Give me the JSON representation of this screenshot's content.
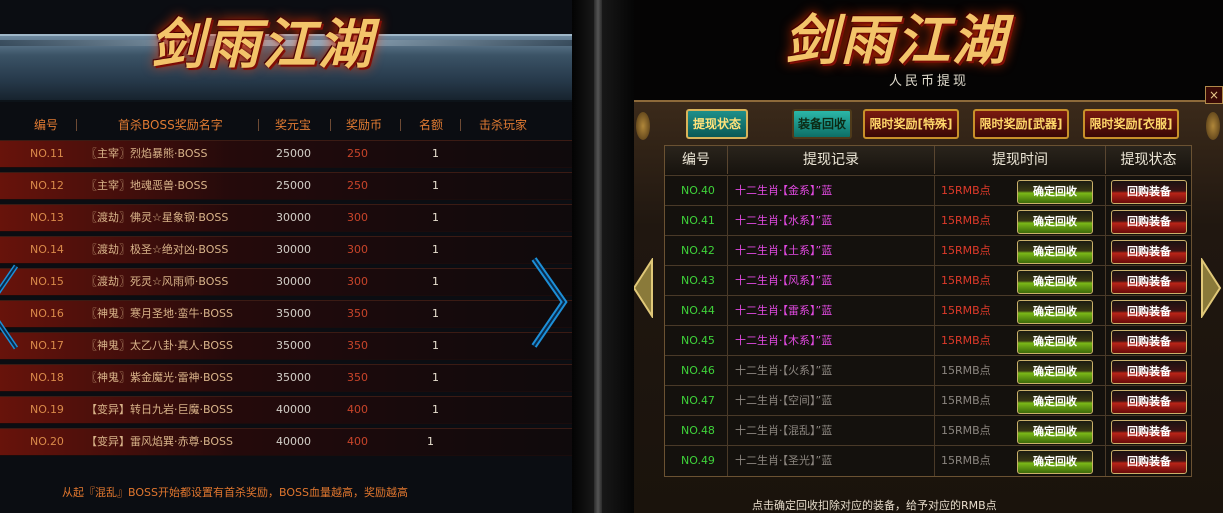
{
  "left": {
    "logo": "剑雨江湖",
    "headers": [
      "编号",
      "首杀BOSS奖励名字",
      "奖元宝",
      "奖励币",
      "名额",
      "击杀玩家"
    ],
    "rows": [
      {
        "no": "NO.11",
        "name": "〖主宰〗烈焰暴熊·BOSS",
        "gold": "25000",
        "coin": "250",
        "rank": "1"
      },
      {
        "no": "NO.12",
        "name": "〖主宰〗地魂恶兽·BOSS",
        "gold": "25000",
        "coin": "250",
        "rank": "1"
      },
      {
        "no": "NO.13",
        "name": "〖渡劫〗佛灵☆星象钢·BOSS",
        "gold": "30000",
        "coin": "300",
        "rank": "1"
      },
      {
        "no": "NO.14",
        "name": "〖渡劫〗极圣☆绝对凶·BOSS",
        "gold": "30000",
        "coin": "300",
        "rank": "1"
      },
      {
        "no": "NO.15",
        "name": "〖渡劫〗死灵☆风雨师·BOSS",
        "gold": "30000",
        "coin": "300",
        "rank": "1"
      },
      {
        "no": "NO.16",
        "name": "〖神鬼〗寒月圣地·蛮牛·BOSS",
        "gold": "35000",
        "coin": "350",
        "rank": "1"
      },
      {
        "no": "NO.17",
        "name": "〖神鬼〗太乙八卦·真人·BOSS",
        "gold": "35000",
        "coin": "350",
        "rank": "1"
      },
      {
        "no": "NO.18",
        "name": "〖神鬼〗紫金魔光·雷神·BOSS",
        "gold": "35000",
        "coin": "350",
        "rank": "1"
      },
      {
        "no": "NO.19",
        "name": "【变异】转日九岩·巨魔·BOSS",
        "gold": "40000",
        "coin": "400",
        "rank": "1"
      },
      {
        "no": "NO.20",
        "name": "【变异】雷风焰巽·赤尊·BOSS",
        "gold": "40000",
        "coin": "400",
        "rank": "1"
      }
    ],
    "note": "从起『混乱』BOSS开始都设置有首杀奖励，BOSS血量越高，奖励越高"
  },
  "right": {
    "logo": "剑雨江湖",
    "subtitle": "人民币提现",
    "close": "×",
    "tabs": {
      "status": "提现状态",
      "equip": "装备回收",
      "special": "限时奖励[特殊]",
      "weapon": "限时奖励[武器]",
      "clothes": "限时奖励[衣服]"
    },
    "headers": [
      "编号",
      "提现记录",
      "提现时间",
      "提现状态"
    ],
    "btn_confirm": "确定回收",
    "btn_buyback": "回购装备",
    "rows": [
      {
        "no": "NO.40",
        "rec": "十二生肖·【金系】”蓝",
        "pts": "15RMB点",
        "active": true
      },
      {
        "no": "NO.41",
        "rec": "十二生肖·【水系】”蓝",
        "pts": "15RMB点",
        "active": true
      },
      {
        "no": "NO.42",
        "rec": "十二生肖·【土系】”蓝",
        "pts": "15RMB点",
        "active": true
      },
      {
        "no": "NO.43",
        "rec": "十二生肖·【风系】”蓝",
        "pts": "15RMB点",
        "active": true
      },
      {
        "no": "NO.44",
        "rec": "十二生肖·【雷系】”蓝",
        "pts": "15RMB点",
        "active": true
      },
      {
        "no": "NO.45",
        "rec": "十二生肖·【木系】”蓝",
        "pts": "15RMB点",
        "active": true
      },
      {
        "no": "NO.46",
        "rec": "十二生肖·【火系】”蓝",
        "pts": "15RMB点",
        "active": false
      },
      {
        "no": "NO.47",
        "rec": "十二生肖·【空间】”蓝",
        "pts": "15RMB点",
        "active": false
      },
      {
        "no": "NO.48",
        "rec": "十二生肖·【混乱】”蓝",
        "pts": "15RMB点",
        "active": false
      },
      {
        "no": "NO.49",
        "rec": "十二生肖·【圣光】”蓝",
        "pts": "15RMB点",
        "active": false
      }
    ],
    "note": "点击确定回收扣除对应的装备，给予对应的RMB点"
  }
}
